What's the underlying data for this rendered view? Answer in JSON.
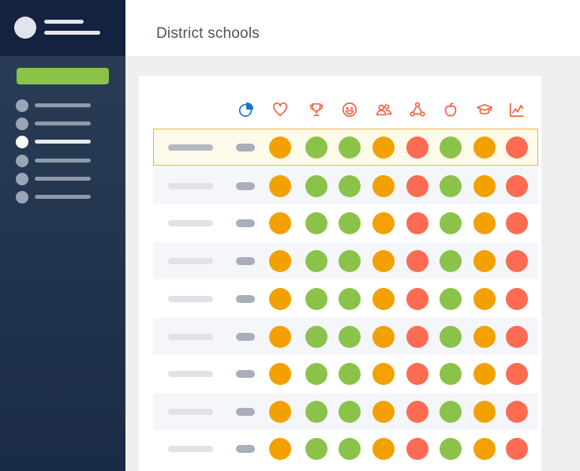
{
  "header": {
    "title": "District schools"
  },
  "columns": [
    {
      "icon": "pie-chart-icon",
      "color": "#1a73c9"
    },
    {
      "icon": "heart-icon",
      "color": "#f0603e"
    },
    {
      "icon": "trophy-icon",
      "color": "#f0603e"
    },
    {
      "icon": "smiley-icon",
      "color": "#f0603e"
    },
    {
      "icon": "people-icon",
      "color": "#f0603e"
    },
    {
      "icon": "network-icon",
      "color": "#f0603e"
    },
    {
      "icon": "apple-icon",
      "color": "#f0603e"
    },
    {
      "icon": "graduation-cap-icon",
      "color": "#f0603e"
    },
    {
      "icon": "line-chart-icon",
      "color": "#f0603e"
    }
  ],
  "status_colors": {
    "orange": "#f2a100",
    "green": "#8bc34a",
    "red": "#fd6b53"
  },
  "rows": [
    {
      "selected": true,
      "statuses": [
        "orange",
        "green",
        "green",
        "orange",
        "red",
        "green",
        "orange",
        "red"
      ]
    },
    {
      "selected": false,
      "statuses": [
        "orange",
        "green",
        "green",
        "orange",
        "red",
        "green",
        "orange",
        "red"
      ]
    },
    {
      "selected": false,
      "statuses": [
        "orange",
        "green",
        "green",
        "orange",
        "red",
        "green",
        "orange",
        "red"
      ]
    },
    {
      "selected": false,
      "statuses": [
        "orange",
        "green",
        "green",
        "orange",
        "red",
        "green",
        "orange",
        "red"
      ]
    },
    {
      "selected": false,
      "statuses": [
        "orange",
        "green",
        "green",
        "orange",
        "red",
        "green",
        "orange",
        "red"
      ]
    },
    {
      "selected": false,
      "statuses": [
        "orange",
        "green",
        "green",
        "orange",
        "red",
        "green",
        "orange",
        "red"
      ]
    },
    {
      "selected": false,
      "statuses": [
        "orange",
        "green",
        "green",
        "orange",
        "red",
        "green",
        "orange",
        "red"
      ]
    },
    {
      "selected": false,
      "statuses": [
        "orange",
        "green",
        "green",
        "orange",
        "red",
        "green",
        "orange",
        "red"
      ]
    },
    {
      "selected": false,
      "statuses": [
        "orange",
        "green",
        "green",
        "orange",
        "red",
        "green",
        "orange",
        "red"
      ]
    }
  ],
  "sidebar": {
    "active_index": 2,
    "item_count": 6
  }
}
